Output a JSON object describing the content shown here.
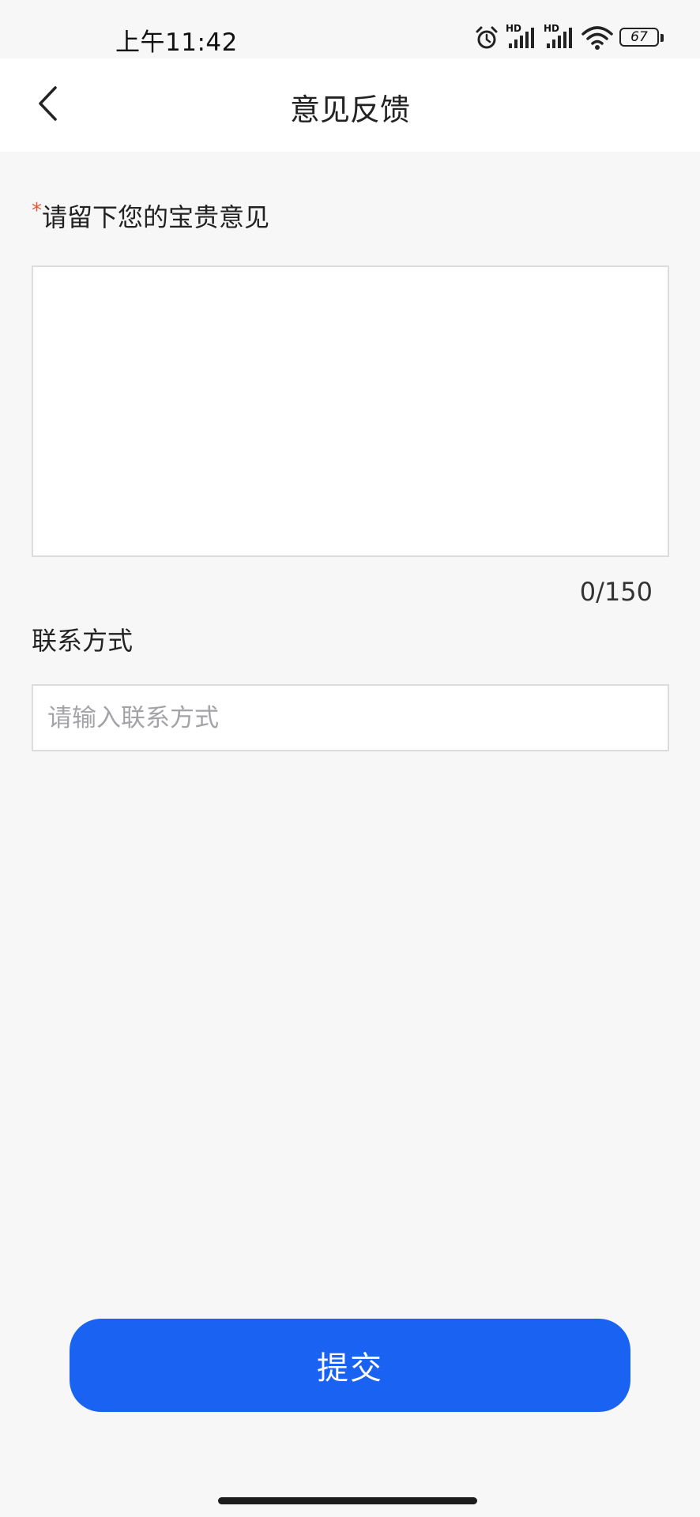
{
  "status_bar": {
    "time": "上午11:42",
    "signal1_label": "HD",
    "signal2_label": "HD",
    "battery_level": "67",
    "icons": [
      "alarm-icon",
      "hd-signal-icon",
      "hd-signal-icon",
      "wifi-icon",
      "battery-icon"
    ]
  },
  "nav": {
    "back_icon": "chevron-left-icon",
    "title": "意见反馈"
  },
  "form": {
    "required_mark": "*",
    "feedback_label": "请留下您的宝贵意见",
    "feedback_value": "",
    "char_count": "0/150",
    "contact_label": "联系方式",
    "contact_value": "",
    "contact_placeholder": "请输入联系方式"
  },
  "actions": {
    "submit_label": "提交"
  },
  "colors": {
    "accent": "#1a63f2",
    "required": "#e8553b",
    "background": "#f7f7f8"
  }
}
